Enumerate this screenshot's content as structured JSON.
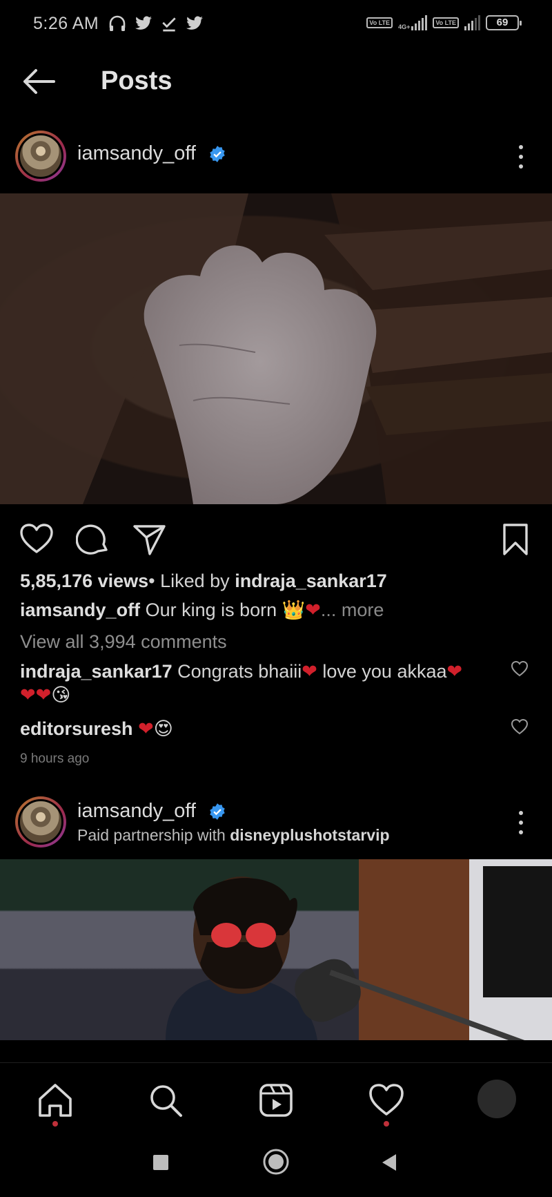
{
  "status_bar": {
    "time": "5:26 AM",
    "left_icons": [
      "headphones-icon",
      "twitter-icon",
      "download-done-icon",
      "twitter-icon"
    ],
    "lte_label": "Vo LTE",
    "network_label": "4G+",
    "battery": "69"
  },
  "header": {
    "title": "Posts"
  },
  "post1": {
    "username": "iamsandy_off",
    "views": "5,85,176 views",
    "liked_by_prefix": "• Liked by ",
    "liked_by_user": "indraja_sankar17",
    "caption_user": "iamsandy_off",
    "caption_text": " Our king is born 👑",
    "caption_heart": "❤",
    "caption_more": "... more",
    "view_comments": "View all 3,994 comments",
    "comments": [
      {
        "user": "indraja_sankar17",
        "text": " Congrats bhaiii",
        "heart": "❤",
        "text2": " love you akkaa",
        "hearts2": "❤❤❤",
        "emoji": "😘"
      },
      {
        "user": "editorsuresh",
        "text": " ",
        "heart": "❤",
        "emoji": "😍"
      }
    ],
    "time_ago": "9 hours ago"
  },
  "post2": {
    "username": "iamsandy_off",
    "partnership_prefix": "Paid partnership with ",
    "partner": "disneyplushotstarvip"
  },
  "colors": {
    "background": "#000000",
    "verified_blue": "#3897f0",
    "heart_red": "#d1202b",
    "notification_dot": "#c0303a"
  }
}
